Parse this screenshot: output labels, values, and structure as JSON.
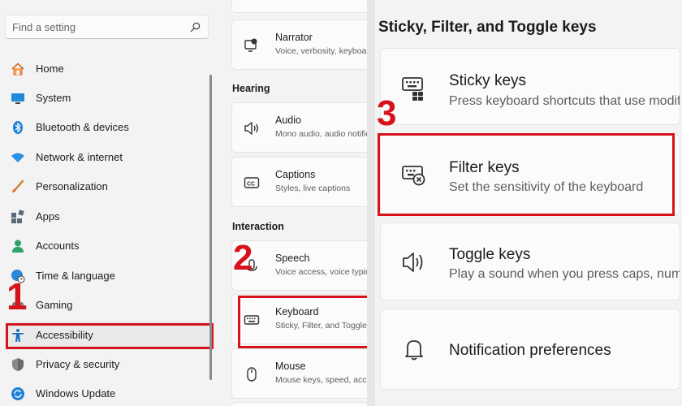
{
  "search": {
    "placeholder": "Find a setting",
    "icon": "search-icon"
  },
  "sidebar": {
    "items": [
      {
        "label": "Home",
        "icon": "home-icon"
      },
      {
        "label": "System",
        "icon": "system-icon"
      },
      {
        "label": "Bluetooth & devices",
        "icon": "bluetooth-icon"
      },
      {
        "label": "Network & internet",
        "icon": "wifi-icon"
      },
      {
        "label": "Personalization",
        "icon": "brush-icon"
      },
      {
        "label": "Apps",
        "icon": "apps-icon"
      },
      {
        "label": "Accounts",
        "icon": "accounts-icon"
      },
      {
        "label": "Time & language",
        "icon": "globe-clock-icon"
      },
      {
        "label": "Gaming",
        "icon": "gaming-icon"
      },
      {
        "label": "Accessibility",
        "icon": "accessibility-icon",
        "active": true
      },
      {
        "label": "Privacy & security",
        "icon": "shield-icon"
      },
      {
        "label": "Windows Update",
        "icon": "update-icon"
      }
    ]
  },
  "middle": {
    "narrator": {
      "title": "Narrator",
      "subtitle": "Voice, verbosity, keyboard"
    },
    "hearing_header": "Hearing",
    "audio": {
      "title": "Audio",
      "subtitle": "Mono audio, audio notifications"
    },
    "captions": {
      "title": "Captions",
      "subtitle": "Styles, live captions"
    },
    "interaction_header": "Interaction",
    "speech": {
      "title": "Speech",
      "subtitle": "Voice access, voice typing"
    },
    "keyboard": {
      "title": "Keyboard",
      "subtitle": "Sticky, Filter, and Toggle keys"
    },
    "mouse": {
      "title": "Mouse",
      "subtitle": "Mouse keys, speed, acceleration"
    }
  },
  "right": {
    "title": "Sticky, Filter, and Toggle keys",
    "sticky": {
      "title": "Sticky keys",
      "subtitle": "Press keyboard shortcuts that use modifier keys one at a time"
    },
    "filter": {
      "title": "Filter keys",
      "subtitle": "Set the sensitivity of the keyboard"
    },
    "toggle": {
      "title": "Toggle keys",
      "subtitle": "Play a sound when you press caps, num, or scroll lock"
    },
    "notifications": {
      "title": "Notification preferences"
    }
  },
  "steps": {
    "one": "1",
    "two": "2",
    "three": "3"
  },
  "colors": {
    "highlight": "#d6121b",
    "accent": "#005fb8"
  }
}
